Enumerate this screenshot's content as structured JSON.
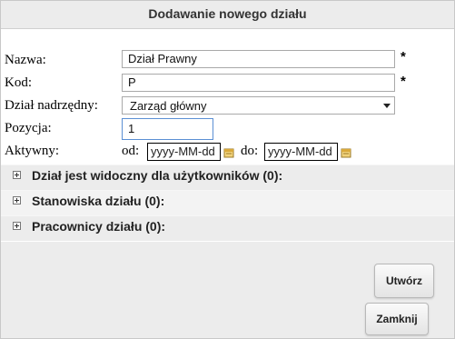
{
  "dialog": {
    "title": "Dodawanie nowego działu"
  },
  "form": {
    "name_label": "Nazwa:",
    "name_value": "Dział Prawny",
    "name_required": "*",
    "code_label": "Kod:",
    "code_value": "P",
    "code_required": "*",
    "parent_label": "Dział nadrzędny:",
    "parent_selected": "Zarząd główny",
    "position_label": "Pozycja:",
    "position_value": "1",
    "active_label": "Aktywny:",
    "from_label": "od:",
    "from_placeholder": "yyyy-MM-dd",
    "to_label": "do:",
    "to_placeholder": "yyyy-MM-dd"
  },
  "sections": [
    {
      "label": "Dział jest widoczny dla użytkowników (0):"
    },
    {
      "label": "Stanowiska działu (0):"
    },
    {
      "label": "Pracownicy działu (0):"
    }
  ],
  "buttons": {
    "create": "Utwórz",
    "close": "Zamknij"
  },
  "icons": {
    "expand": "plus-box-icon",
    "calendar": "calendar-icon"
  }
}
